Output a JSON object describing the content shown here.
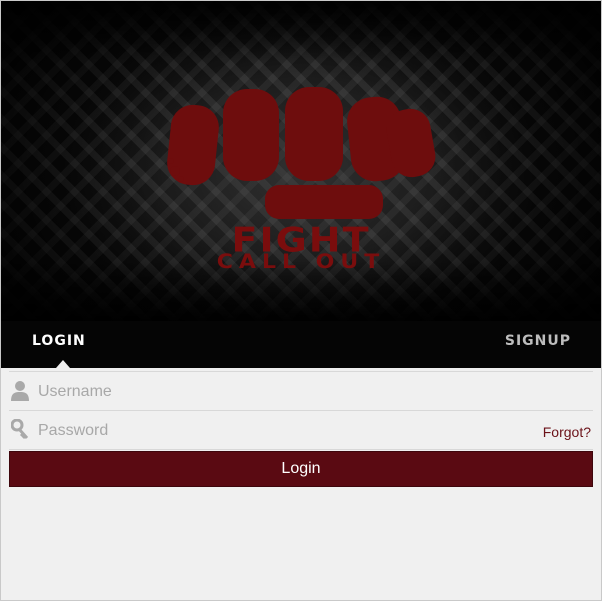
{
  "brand": {
    "logo_line1": "FIGHT",
    "logo_line2": "CALL OUT",
    "accent_color": "#7a0d0d"
  },
  "tabs": {
    "login": "LOGIN",
    "signup": "SIGNUP",
    "active": "login"
  },
  "form": {
    "username": {
      "placeholder": "Username",
      "value": "",
      "icon": "user-icon"
    },
    "password": {
      "placeholder": "Password",
      "value": "",
      "icon": "key-icon"
    },
    "forgot_label": "Forgot?",
    "submit_label": "Login",
    "button_color": "#5a0a12"
  }
}
